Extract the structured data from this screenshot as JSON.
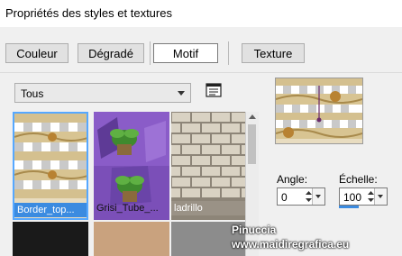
{
  "window": {
    "title": "Propriétés des styles et textures"
  },
  "tabs": [
    {
      "label": "Couleur",
      "active": false
    },
    {
      "label": "Dégradé",
      "active": false
    },
    {
      "label": "Motif",
      "active": true
    },
    {
      "label": "Texture",
      "active": false
    }
  ],
  "category_dropdown": {
    "selected": "Tous"
  },
  "patterns": [
    {
      "label": "Border_top...",
      "selected": true
    },
    {
      "label": "Grisi_Tube_...",
      "selected": false
    },
    {
      "label": "ladrillo",
      "selected": false
    }
  ],
  "angle": {
    "label": "Angle:",
    "value": "0"
  },
  "scale": {
    "label": "Échelle:",
    "value": "100"
  },
  "watermark": {
    "line1": "Pinuccia",
    "line2": "www.maidiregrafica.eu"
  },
  "colors": {
    "accent": "#3b8be0",
    "selection_border": "#56a8ff"
  },
  "icons": [
    "notes-icon",
    "spin-up-icon",
    "spin-down-icon",
    "dropdown-arrow-icon",
    "target-cursor-icon"
  ]
}
